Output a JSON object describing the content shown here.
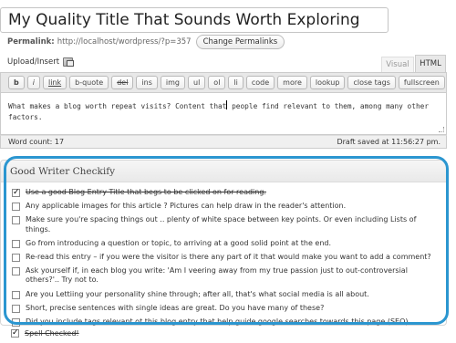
{
  "post": {
    "title": "My Quality Title That Sounds Worth Exploring",
    "permalink_label": "Permalink:",
    "permalink_url": "http://localhost/wordpress/?p=357",
    "change_permalinks_label": "Change Permalinks"
  },
  "upload": {
    "label": "Upload/Insert",
    "icon": "media-icon"
  },
  "editor_tabs": [
    {
      "label": "Visual",
      "active": false
    },
    {
      "label": "HTML",
      "active": true
    }
  ],
  "toolbar": {
    "buttons": [
      "b",
      "i",
      "link",
      "b-quote",
      "del",
      "ins",
      "img",
      "ul",
      "ol",
      "li",
      "code",
      "more",
      "lookup",
      "close tags",
      "fullscreen"
    ]
  },
  "editor": {
    "content": "What makes a blog worth repeat visits?  Content that people find relevant to them, among many other factors."
  },
  "status": {
    "word_count": "Word count: 17",
    "draft_saved": "Draft saved at 11:56:27 pm."
  },
  "checkify": {
    "title": "Good Writer Checkify",
    "items": [
      {
        "text": "Use a good Blog Entry Title that begs to be clicked on for reading.",
        "checked": true
      },
      {
        "text": "Any applicable images for this article ? Pictures can help draw in the reader's attention.",
        "checked": false
      },
      {
        "text": "Make sure you're spacing things out .. plenty of white space between key points. Or even including Lists of things.",
        "checked": false
      },
      {
        "text": "Go from introducing a question or topic, to arriving at a good solid point at the end.",
        "checked": false
      },
      {
        "text": "Re-read this entry – if you were the visitor is there any part of it that would make you want to add a comment?",
        "checked": false
      },
      {
        "text": "Ask yourself if, in each blog you write: 'Am I veering away from my true passion just to out-controversial others?'.. Try not to.",
        "checked": false
      },
      {
        "text": "Are you Lettiing your personality shine through; after all, that's what social media is all about.",
        "checked": false
      },
      {
        "text": "Short, precise sentences with single ideas are great. Do you have many of these?",
        "checked": false
      },
      {
        "text": "Did you include tags relevant ot this blog entry that help guide google searches towards this page (SEO).",
        "checked": false
      }
    ]
  },
  "spell_check": {
    "text": "Spell Checked!",
    "checked": true
  },
  "colors": {
    "highlight_ring": "#2b96d0"
  }
}
